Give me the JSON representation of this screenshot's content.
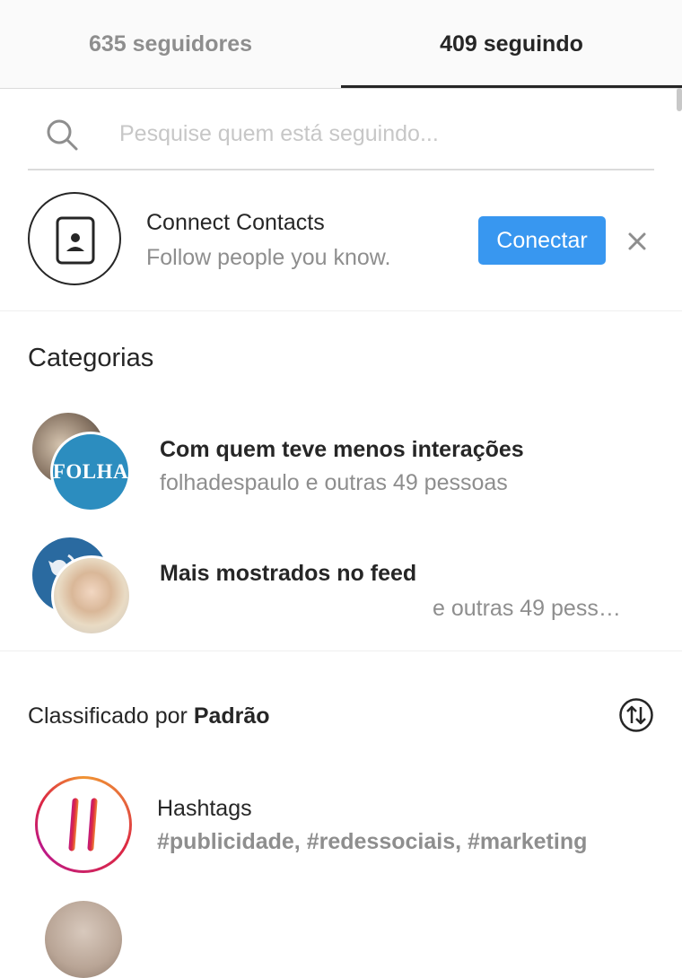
{
  "tabs": {
    "followers": "635 seguidores",
    "following": "409 seguindo"
  },
  "search": {
    "placeholder": "Pesquise quem está seguindo..."
  },
  "connect": {
    "title": "Connect Contacts",
    "subtitle": "Follow people you know.",
    "button": "Conectar",
    "close": "×"
  },
  "categories": {
    "heading": "Categorias",
    "items": [
      {
        "label": "Com quem teve menos interações",
        "desc": "folhadespaulo e outras 49 pessoas",
        "avatar_text": "FOLHA"
      },
      {
        "label": "Mais mostrados no feed",
        "desc": "e outras 49 pess…"
      }
    ]
  },
  "sort": {
    "prefix": "Classificado por ",
    "value": "Padrão"
  },
  "list": [
    {
      "title": "Hashtags",
      "subtitle": "#publicidade, #redessociais, #marketing"
    }
  ],
  "colors": {
    "accent": "#3897f0",
    "text": "#262626",
    "muted": "#8e8e8e",
    "folha": "#2c8dbf"
  }
}
